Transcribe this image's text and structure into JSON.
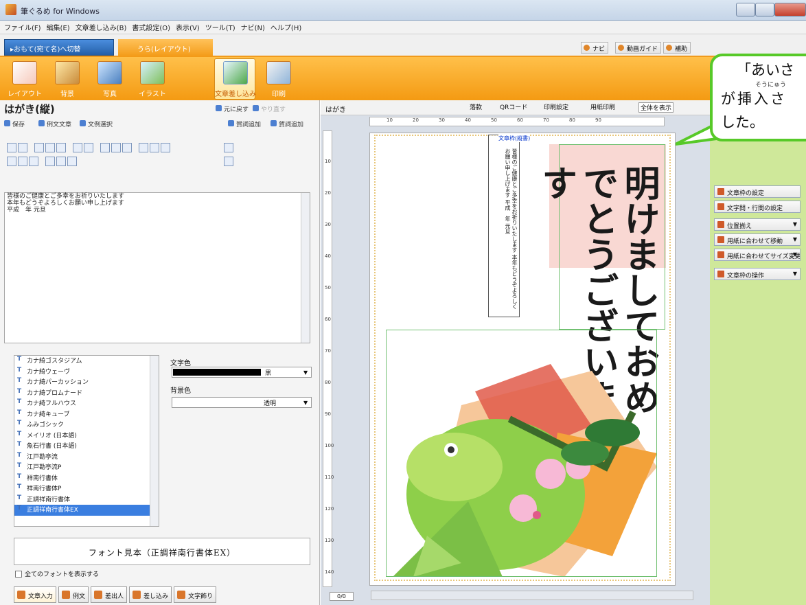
{
  "window": {
    "title": "筆ぐるめ for Windows"
  },
  "menu": [
    "ファイル(F)",
    "編集(E)",
    "文章差し込み(B)",
    "書式設定(O)",
    "表示(V)",
    "ツール(T)",
    "ナビ(N)",
    "ヘルプ(H)"
  ],
  "tabs": {
    "front": "▸おもて(宛て名)へ切替",
    "back": "うら(レイアウト)"
  },
  "top_buttons": [
    "ナビ",
    "動画ガイド",
    "補助"
  ],
  "ribbon": [
    {
      "label": "レイアウト",
      "icon": "layout-icon"
    },
    {
      "label": "背景",
      "icon": "background-icon"
    },
    {
      "label": "写真",
      "icon": "photo-icon"
    },
    {
      "label": "イラスト",
      "icon": "illustration-icon"
    },
    {
      "label": "文章差し込み",
      "icon": "insert-text-icon"
    },
    {
      "label": "印刷",
      "icon": "print-icon"
    }
  ],
  "ribbon_brand": "筆",
  "left": {
    "title": "はがき(縦)",
    "undo": "元に戻す",
    "redo": "やり直す",
    "save": "保存",
    "sample_text": "例文文章",
    "select_text": "文例選択",
    "add_greeting": "賀詞追加",
    "add_greeting2": "賀詞追加"
  },
  "editor_lines": [
    "皆様のご健康とご多幸をお祈りいたします",
    "本年もどうぞよろしくお願い申し上げます",
    "平成　年 元旦"
  ],
  "fonts": [
    "カナ綺ゴスタジアム",
    "カナ綺ウェーヴ",
    "カナ綺パーカッション",
    "カナ綺プロムナード",
    "カナ綺フルハウス",
    "カナ綺キューブ",
    "ふみゴシック",
    "メイリオ (日本語)",
    "魚石行書 (日本語)",
    "江戸勘亭流",
    "江戸勘亭流P",
    "祥南行書体",
    "祥南行書体P",
    "正調祥南行書体",
    "正調祥南行書体EX"
  ],
  "font_color": {
    "label": "文字色",
    "value": "黒"
  },
  "bg_color": {
    "label": "背景色",
    "value": "透明"
  },
  "font_sample": "フォント見本（正調祥南行書体EX）",
  "show_all_fonts": "全てのフォントを表示する",
  "bottom_tabs": [
    "文章入力",
    "例文",
    "差出人",
    "差し込み",
    "文字飾り"
  ],
  "canvas": {
    "label": "はがき",
    "tools": [
      "落款",
      "QRコード",
      "印刷設定",
      "用紙印刷",
      "全体を表示"
    ],
    "ruler_top": [
      "10",
      "20",
      "30",
      "40",
      "50",
      "60",
      "70",
      "80",
      "90"
    ],
    "ruler_left": [
      "10",
      "20",
      "30",
      "40",
      "50",
      "60",
      "70",
      "80",
      "90",
      "100",
      "110",
      "120",
      "130",
      "140"
    ],
    "greeting_main": "明けましておめでとうございます",
    "frame_tag": "文章枠(縦書)",
    "frame_text": "皆様のご健康とご多幸をお祈りいたします 本年もどうぞよろしくお願い申し上げます 平成　年 元旦",
    "page": "0/0"
  },
  "right": {
    "buttons": [
      "文章枠の設定",
      "文字間・行間の設定",
      "位置揃え",
      "用紙に合わせて移動",
      "用紙に合わせてサイズ変更",
      "文章枠の操作"
    ]
  },
  "callout": {
    "line1": "「あいさ",
    "ruby": "そうにゅう",
    "line2": "が挿入さ",
    "line3": "した。"
  },
  "colors": {
    "accent": "#f49a12",
    "callout_border": "#57c928",
    "right_panel": "#cfe89a"
  }
}
